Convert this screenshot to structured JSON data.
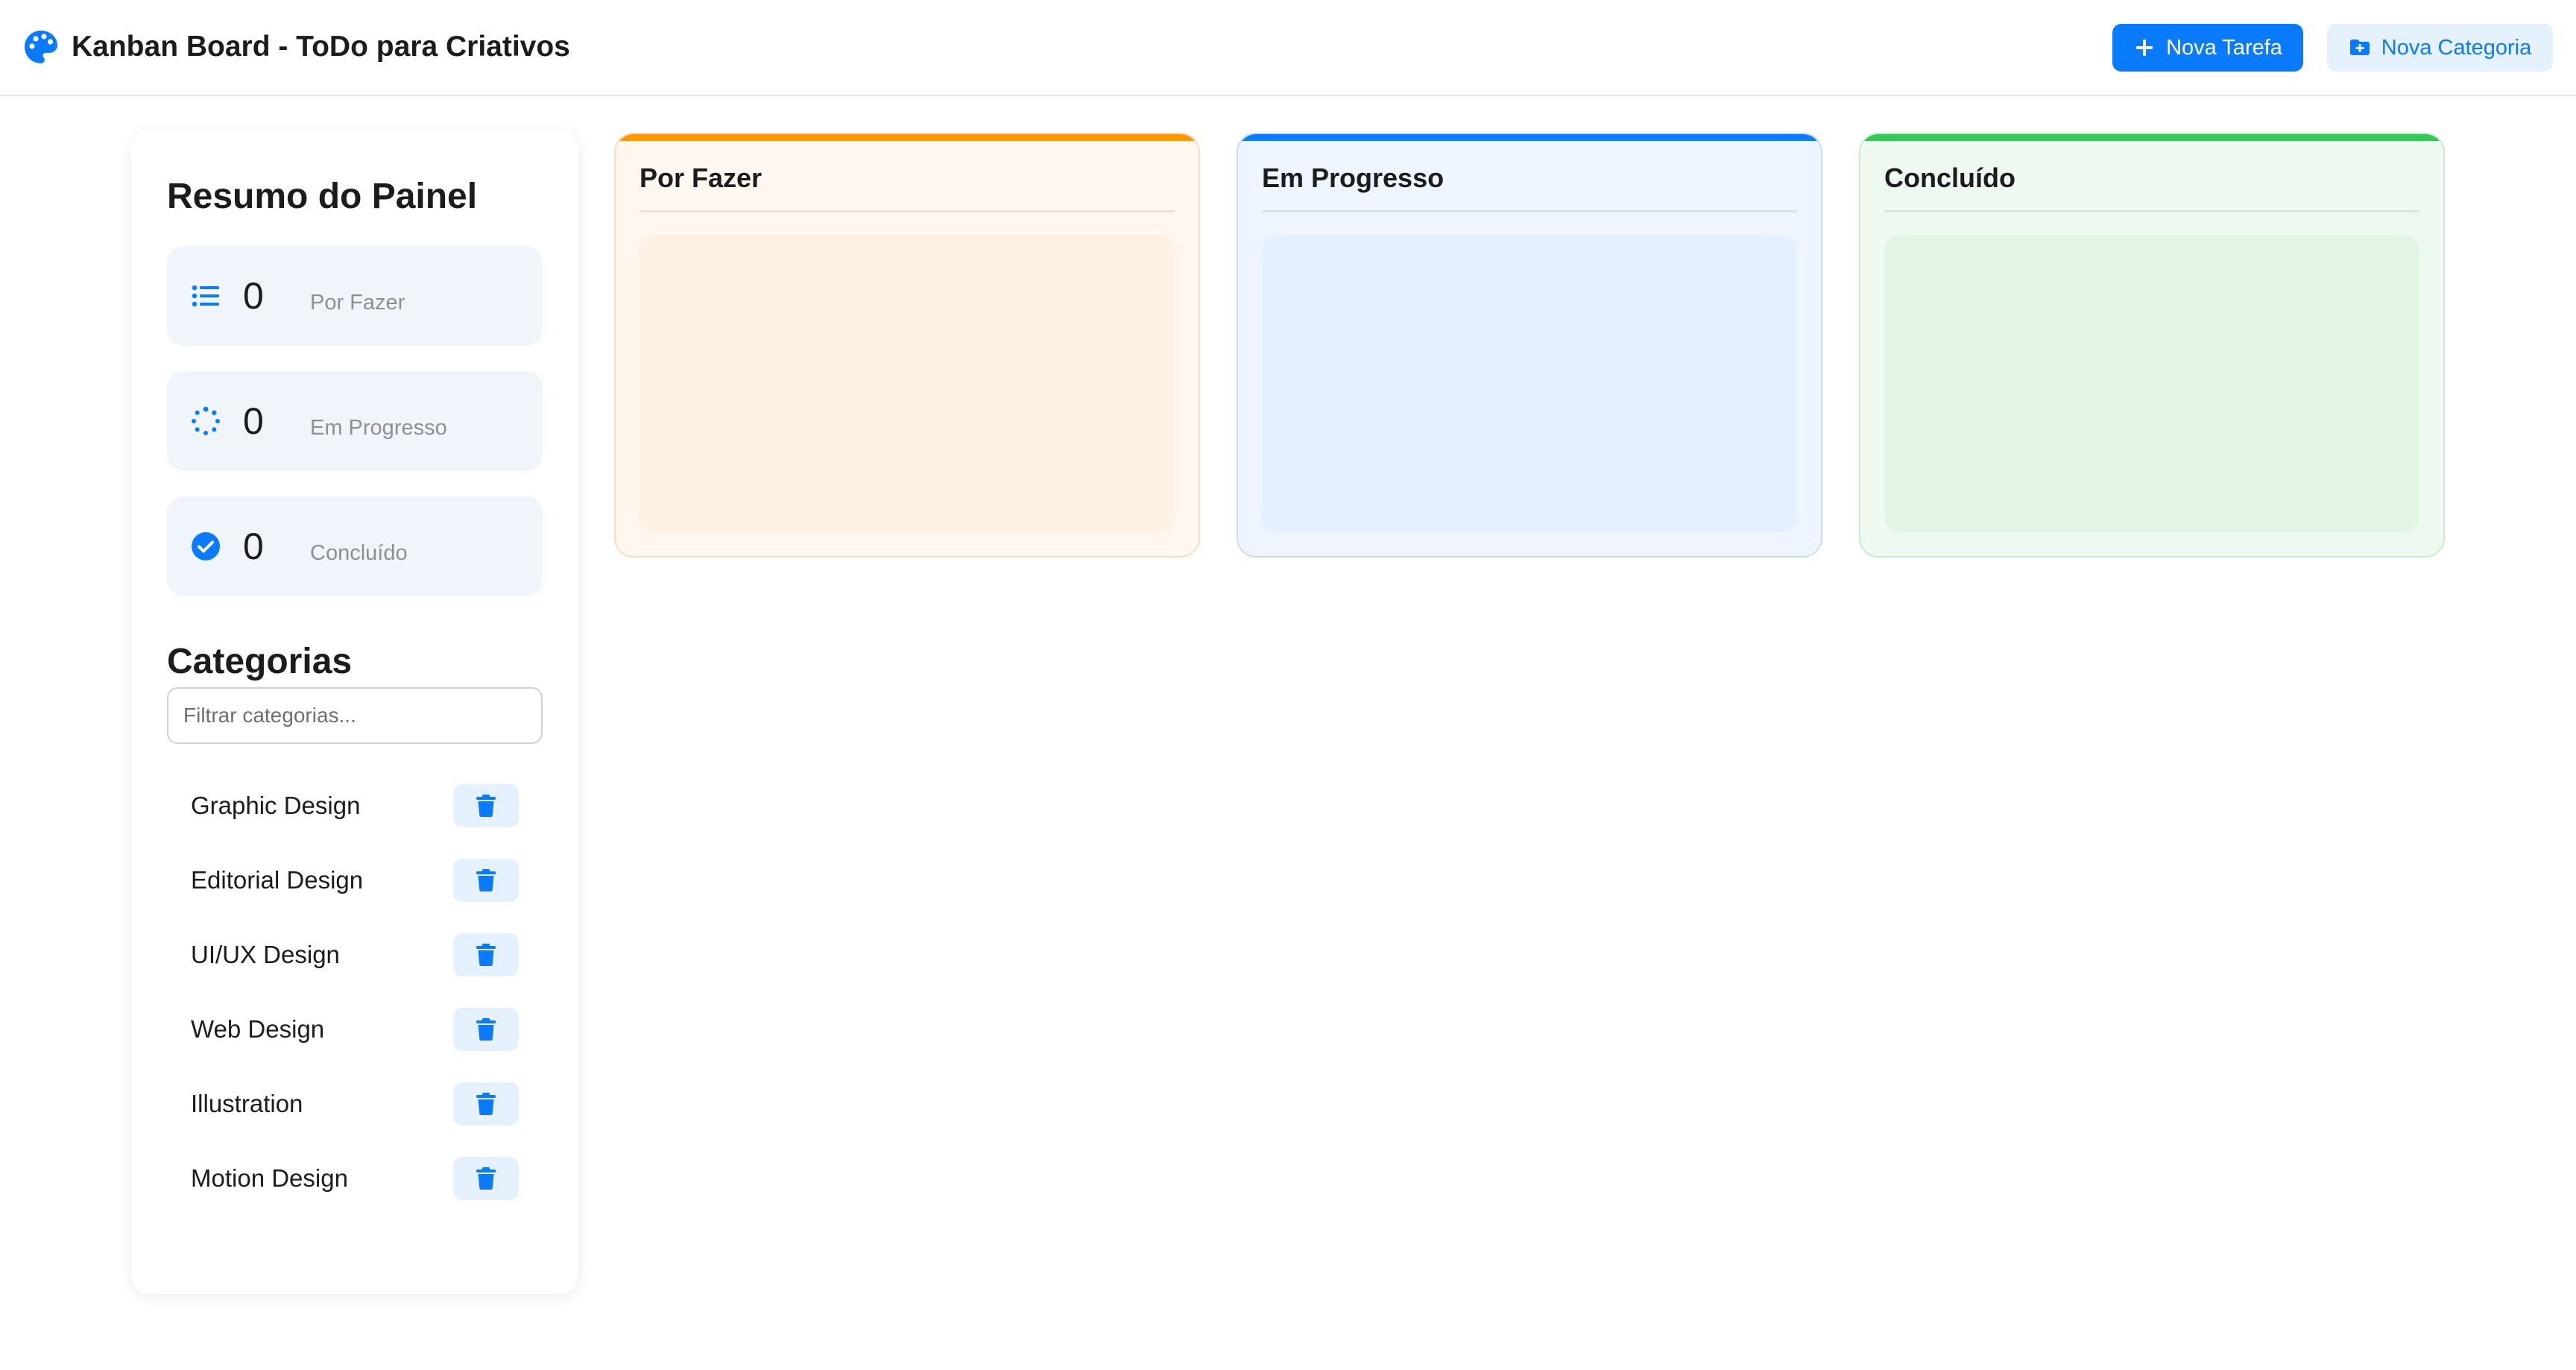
{
  "header": {
    "title": "Kanban Board - ToDo para Criativos",
    "new_task_label": "Nova Tarefa",
    "new_category_label": "Nova Categoria",
    "icons": {
      "brand": "palette-icon",
      "new_task": "plus-icon",
      "new_category": "folder-plus-icon"
    }
  },
  "sidebar": {
    "summary_title": "Resumo do Painel",
    "stats": [
      {
        "count": "0",
        "label": "Por Fazer",
        "icon": "list-icon"
      },
      {
        "count": "0",
        "label": "Em Progresso",
        "icon": "spinner-icon"
      },
      {
        "count": "0",
        "label": "Concluído",
        "icon": "check-circle-icon"
      }
    ],
    "categories_title": "Categorias",
    "filter_placeholder": "Filtrar categorias...",
    "filter_value": "",
    "categories": [
      {
        "label": "Graphic Design"
      },
      {
        "label": "Editorial Design"
      },
      {
        "label": "UI/UX Design"
      },
      {
        "label": "Web Design"
      },
      {
        "label": "Illustration"
      },
      {
        "label": "Motion Design"
      }
    ],
    "delete_icon": "trash-icon"
  },
  "board": {
    "columns": [
      {
        "title": "Por Fazer",
        "accent": "#ff9500"
      },
      {
        "title": "Em Progresso",
        "accent": "#0a7aff"
      },
      {
        "title": "Concluído",
        "accent": "#34c759"
      }
    ]
  },
  "colors": {
    "primary": "#0a7aff",
    "primary_light": "#e5f1ff",
    "todo": "#ff9500",
    "progress": "#0a7aff",
    "done": "#34c759"
  }
}
